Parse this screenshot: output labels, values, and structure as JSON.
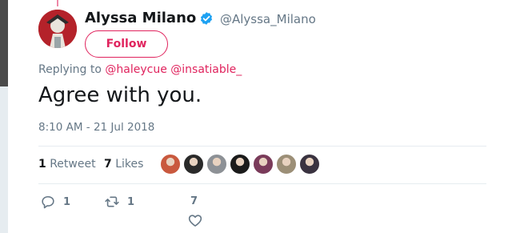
{
  "tweet": {
    "author_name": "Alyssa Milano",
    "author_handle": "@Alyssa_Milano",
    "follow_label": "Follow",
    "replying_prefix": "Replying to",
    "replying_to": [
      "@haleycue",
      "@insatiable_"
    ],
    "text": "Agree with you.",
    "timestamp": "8:10 AM - 21 Jul 2018"
  },
  "stats": {
    "retweets_count": "1",
    "retweets_label": "Retweet",
    "likes_count": "7",
    "likes_label": "Likes"
  },
  "likers": [
    {
      "name": "liker-1",
      "color": "#c9593e"
    },
    {
      "name": "liker-2",
      "color": "#2a2a2a"
    },
    {
      "name": "liker-3",
      "color": "#8d9196"
    },
    {
      "name": "liker-4",
      "color": "#1b1b1b"
    },
    {
      "name": "liker-5",
      "color": "#7a3b5a"
    },
    {
      "name": "liker-6",
      "color": "#9c8f77"
    },
    {
      "name": "liker-7",
      "color": "#3a3340"
    }
  ],
  "actions": {
    "reply_count": "1",
    "retweet_count": "1",
    "like_count": "7"
  },
  "colors": {
    "accent": "#e0245e",
    "secondary_text": "#657786",
    "verified": "#1da1f2",
    "divider": "#e6ecf0"
  },
  "icons": {
    "reply": "reply-icon",
    "retweet": "retweet-icon",
    "like": "heart-icon",
    "verified": "verified-badge-icon"
  }
}
